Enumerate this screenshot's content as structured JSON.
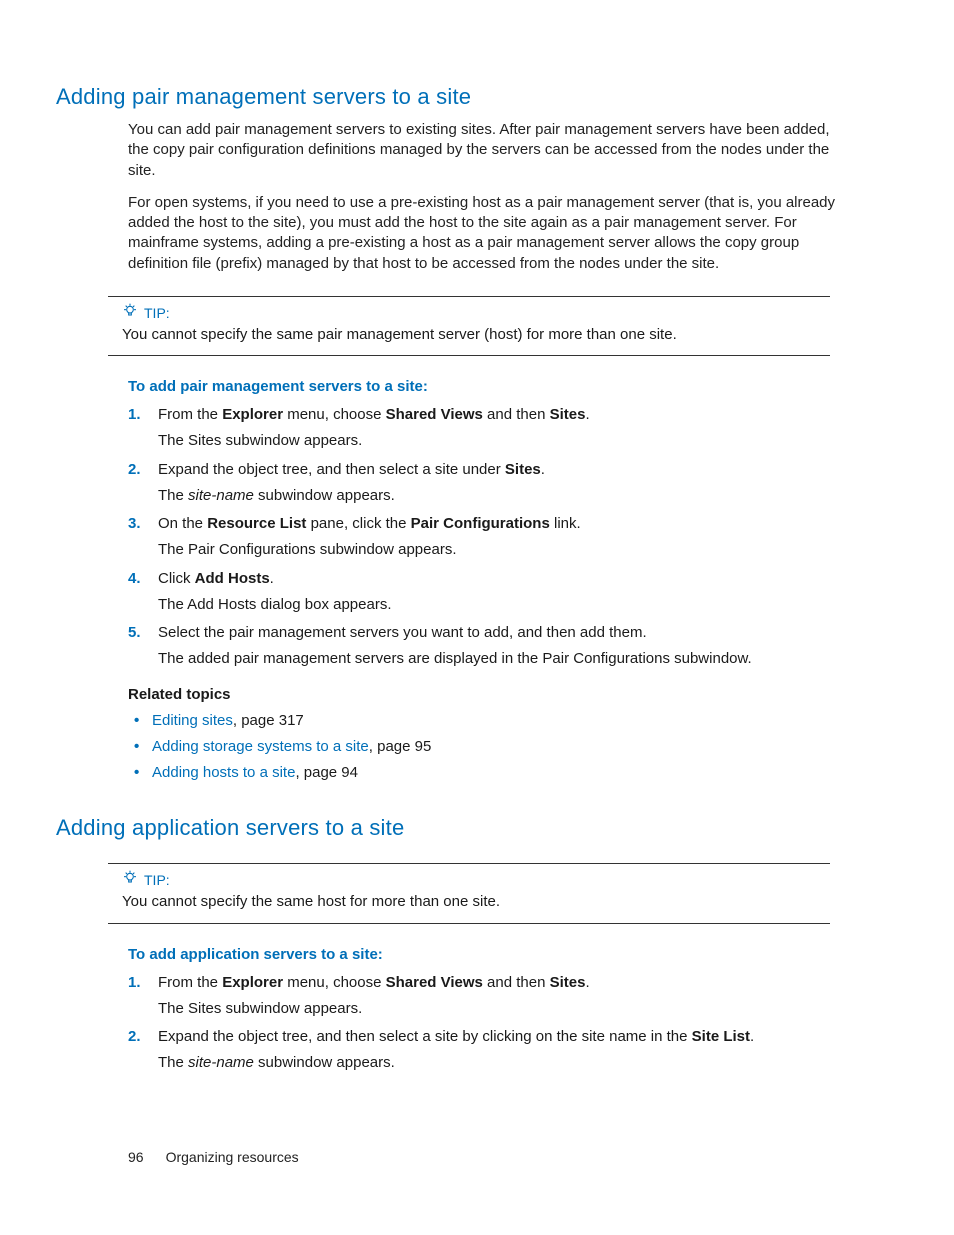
{
  "section1": {
    "title": "Adding pair management servers to a site",
    "para1": "You can add pair management servers to existing sites. After pair management servers have been added, the copy pair configuration definitions managed by the servers can be accessed from the nodes under the site.",
    "para2": "For open systems, if you need to use a pre-existing host as a pair management server (that is, you already added the host to the site), you must add the host to the site again as a pair management server. For mainframe systems, adding a pre-existing a host as a pair management server allows the copy group definition file (prefix) managed by that host to be accessed from the nodes under the site.",
    "tip_label": "TIP:",
    "tip_text": "You cannot specify the same pair management server (host) for more than one site.",
    "procedure_title": "To add pair management servers to a site:",
    "steps": [
      {
        "num": "1.",
        "pieces": [
          "From the ",
          "Explorer",
          " menu, choose ",
          "Shared Views",
          " and then ",
          "Sites",
          "."
        ],
        "follow": "The Sites subwindow appears."
      },
      {
        "num": "2.",
        "pieces": [
          "Expand the object tree, and then select a site under ",
          "Sites",
          "."
        ],
        "follow_pre": "The ",
        "follow_it": "site-name",
        "follow_post": " subwindow appears."
      },
      {
        "num": "3.",
        "pieces": [
          "On the ",
          "Resource List",
          " pane, click the ",
          "Pair Configurations",
          " link."
        ],
        "follow": "The Pair Configurations subwindow appears."
      },
      {
        "num": "4.",
        "pieces": [
          "Click ",
          "Add Hosts",
          "."
        ],
        "follow": "The Add Hosts dialog box appears."
      },
      {
        "num": "5.",
        "line": "Select the pair management servers you want to add, and then add them.",
        "follow": "The added pair management servers are displayed in the Pair Configurations subwindow."
      }
    ],
    "related_title": "Related topics",
    "related": [
      {
        "link": "Editing sites",
        "suffix": ", page 317"
      },
      {
        "link": "Adding storage systems to a site",
        "suffix": ", page 95"
      },
      {
        "link": "Adding hosts to a site",
        "suffix": ", page 94"
      }
    ]
  },
  "section2": {
    "title": "Adding application servers to a site",
    "tip_label": "TIP:",
    "tip_text": "You cannot specify the same host for more than one site.",
    "procedure_title": "To add application servers to a site:",
    "steps": [
      {
        "num": "1.",
        "pieces": [
          "From the ",
          "Explorer",
          " menu, choose ",
          "Shared Views",
          " and then ",
          "Sites",
          "."
        ],
        "follow": "The Sites subwindow appears."
      },
      {
        "num": "2.",
        "pieces": [
          "Expand the object tree, and then select a site by clicking on the site name in the ",
          "Site List",
          "."
        ],
        "follow_pre": "The ",
        "follow_it": "site-name",
        "follow_post": " subwindow appears."
      }
    ]
  },
  "footer": {
    "page_number": "96",
    "chapter": "Organizing resources"
  }
}
